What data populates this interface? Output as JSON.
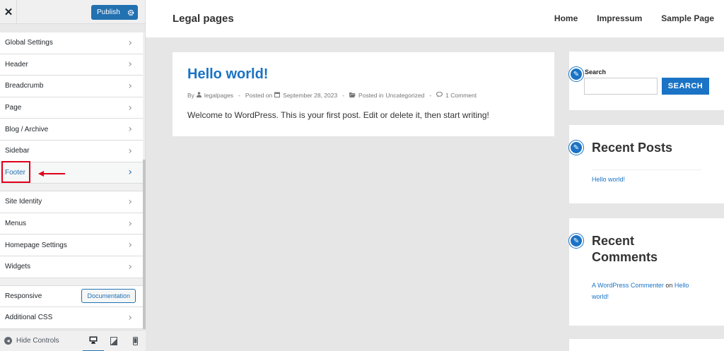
{
  "sidebar": {
    "close_glyph": "✕",
    "publish_label": "Publish",
    "publish_settings_icon": "gear-icon",
    "items_group1": [
      {
        "label": "Global Settings"
      },
      {
        "label": "Header"
      },
      {
        "label": "Breadcrumb"
      },
      {
        "label": "Page"
      },
      {
        "label": "Blog / Archive"
      },
      {
        "label": "Sidebar"
      },
      {
        "label": "Footer",
        "active": true
      }
    ],
    "items_group2": [
      {
        "label": "Site Identity"
      },
      {
        "label": "Menus"
      },
      {
        "label": "Homepage Settings"
      },
      {
        "label": "Widgets"
      }
    ],
    "responsive_label": "Responsive",
    "documentation_label": "Documentation",
    "additional_css_label": "Additional CSS",
    "hide_controls_label": "Hide Controls",
    "devices": [
      "desktop-icon",
      "tablet-icon",
      "mobile-icon"
    ],
    "annotation_color": "#e0001b"
  },
  "site": {
    "title": "Legal pages",
    "nav": [
      "Home",
      "Impressum",
      "Sample Page"
    ],
    "accent_color": "#1a73c5"
  },
  "post": {
    "title": "Hello world!",
    "meta": {
      "by_label": "By",
      "author": "legalpages",
      "posted_on_label": "Posted on",
      "date": "September 28, 2023",
      "posted_in_label": "Posted in",
      "category": "Uncategorized",
      "comments": "1 Comment"
    },
    "body": "Welcome to WordPress. This is your first post. Edit or delete it, then start writing!"
  },
  "widgets": {
    "search": {
      "label": "Search",
      "button": "SEARCH",
      "value": ""
    },
    "recent_posts": {
      "title_line1": "Recent Posts",
      "items": [
        "Hello world!"
      ]
    },
    "recent_comments": {
      "title_line1": "Recent",
      "title_line2": "Comments",
      "author_link": "A WordPress Commenter",
      "on_label": "on",
      "post_link_line1": "Hello",
      "post_link_line2": "world!"
    }
  }
}
